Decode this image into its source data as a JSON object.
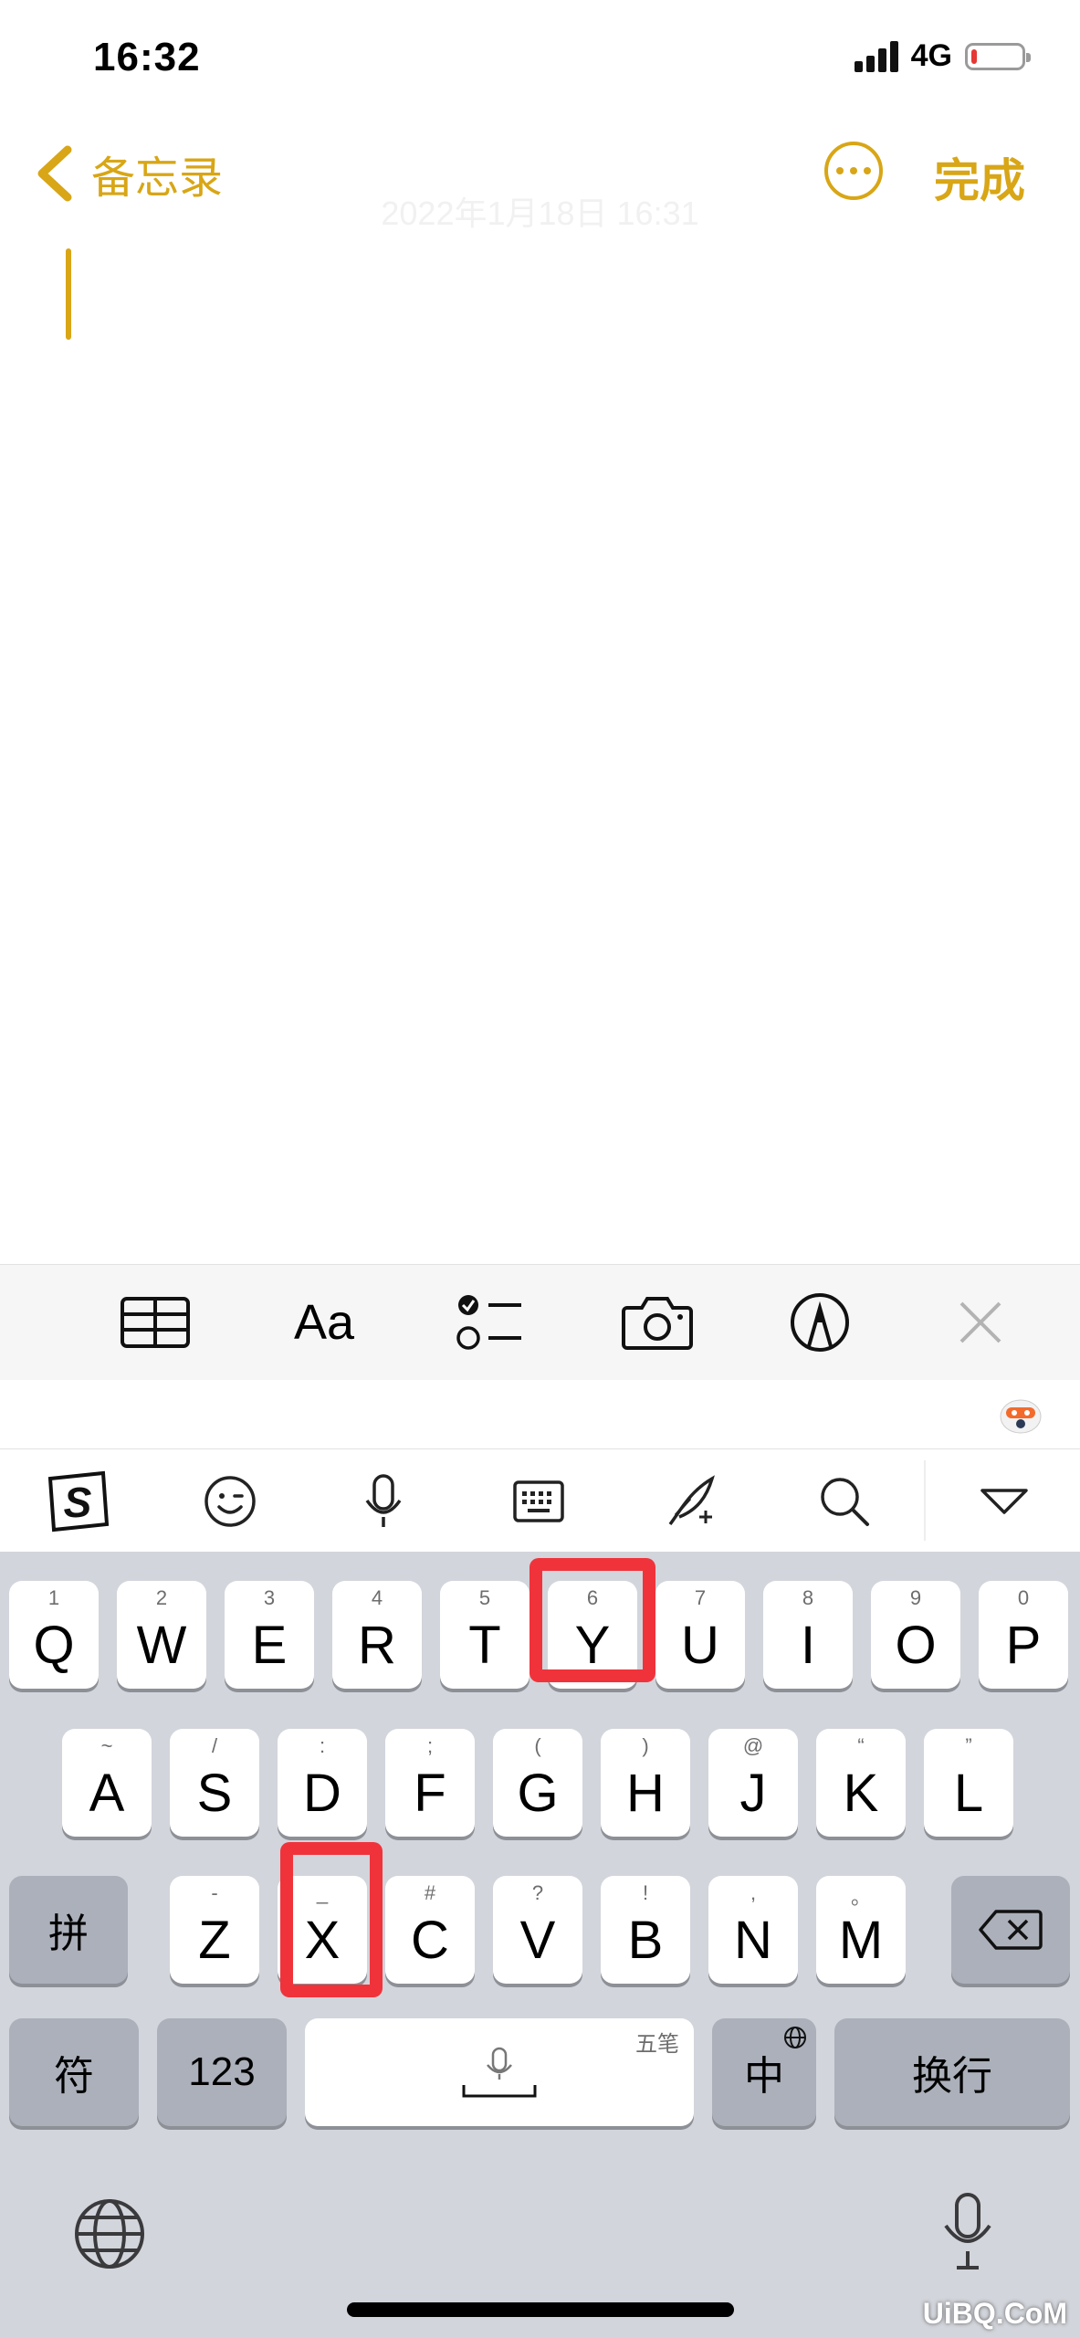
{
  "status": {
    "time": "16:32",
    "network": "4G",
    "battery_level": 0.12,
    "battery_color": "#e53935"
  },
  "nav": {
    "back_label": "备忘录",
    "done_label": "完成",
    "accent_color": "#D8A616"
  },
  "note": {
    "date": "2022年1月18日 16:31"
  },
  "format_toolbar": {
    "items": [
      "table-icon",
      "text-format",
      "checklist-icon",
      "camera-icon",
      "markup-icon",
      "close-icon"
    ],
    "text_format_label": "Aa"
  },
  "ime_toolbar": {
    "items": [
      "sogou-logo-icon",
      "emoji-icon",
      "mic-icon",
      "keyboard-icon",
      "handwriting-icon",
      "search-icon",
      "collapse-icon"
    ],
    "logo_letter": "S"
  },
  "keyboard": {
    "row1": [
      {
        "key": "Q",
        "sub": "1"
      },
      {
        "key": "W",
        "sub": "2"
      },
      {
        "key": "E",
        "sub": "3"
      },
      {
        "key": "R",
        "sub": "4"
      },
      {
        "key": "T",
        "sub": "5"
      },
      {
        "key": "Y",
        "sub": "6"
      },
      {
        "key": "U",
        "sub": "7"
      },
      {
        "key": "I",
        "sub": "8"
      },
      {
        "key": "O",
        "sub": "9"
      },
      {
        "key": "P",
        "sub": "0"
      }
    ],
    "row2": [
      {
        "key": "A",
        "sub": "~"
      },
      {
        "key": "S",
        "sub": "/"
      },
      {
        "key": "D",
        "sub": ":"
      },
      {
        "key": "F",
        "sub": ";"
      },
      {
        "key": "G",
        "sub": "("
      },
      {
        "key": "H",
        "sub": ")"
      },
      {
        "key": "J",
        "sub": "@"
      },
      {
        "key": "K",
        "sub": "“"
      },
      {
        "key": "L",
        "sub": "”"
      }
    ],
    "row3": [
      {
        "key": "Z",
        "sub": "-"
      },
      {
        "key": "X",
        "sub": "_"
      },
      {
        "key": "C",
        "sub": "#"
      },
      {
        "key": "V",
        "sub": "?"
      },
      {
        "key": "B",
        "sub": "!"
      },
      {
        "key": "N",
        "sub": ","
      },
      {
        "key": "M",
        "sub": "。"
      }
    ],
    "pinyin_label": "拼",
    "symbols_label": "符",
    "numbers_label": "123",
    "space_hint": "五笔",
    "lang_label": "中",
    "return_label": "换行"
  },
  "highlights": [
    "Y",
    "X"
  ],
  "highlight_color": "#f0333b",
  "watermark": "UiBQ.CoM"
}
